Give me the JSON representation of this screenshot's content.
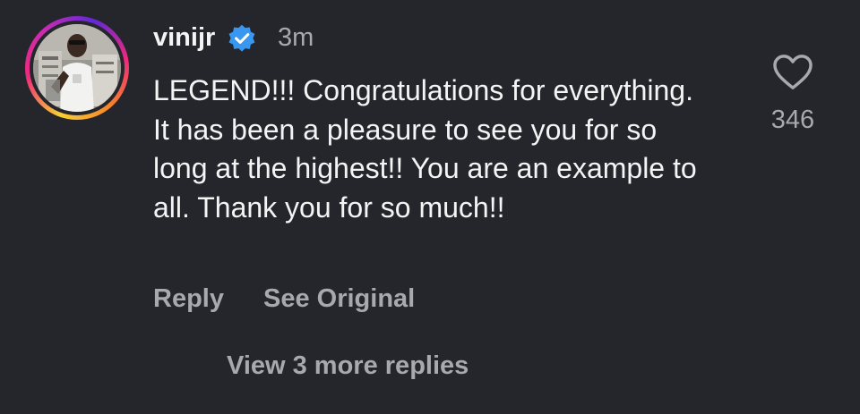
{
  "comment": {
    "username": "vinijr",
    "timestamp": "3m",
    "text": "LEGEND!!! Congratulations for everything. It has been a pleasure to see you for so long at the highest!! You are an example to all. Thank you for so much!!",
    "like_count": "346",
    "actions": {
      "reply_label": "Reply",
      "see_original_label": "See Original"
    },
    "view_replies_label": "View 3 more replies",
    "verified": true,
    "like_icon": "heart-outline-icon"
  },
  "colors": {
    "background": "#24262b",
    "text_primary": "#f4f4f5",
    "text_secondary": "#a8a8ad",
    "verified_badge": "#3897f0"
  }
}
